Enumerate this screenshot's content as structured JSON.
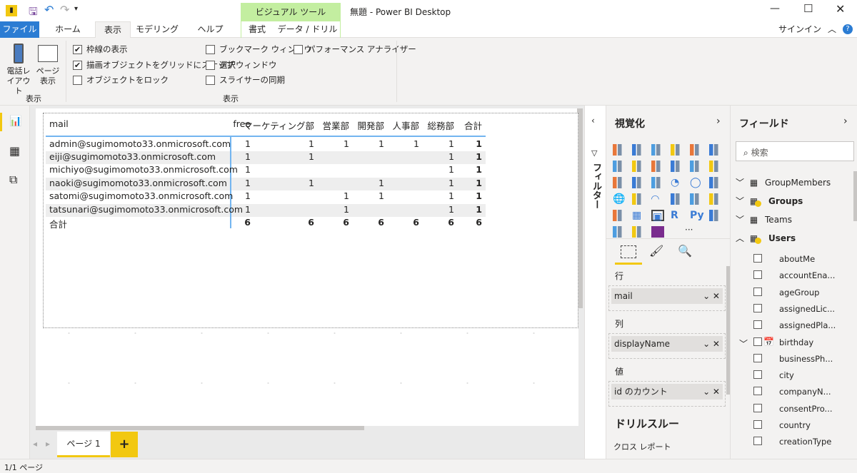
{
  "window": {
    "title": "無題 - Power BI Desktop",
    "signin": "サインイン",
    "contextual_group": "ビジュアル ツール"
  },
  "tabs": [
    "ファイル",
    "ホーム",
    "表示",
    "モデリング",
    "ヘルプ",
    "書式",
    "データ / ドリル"
  ],
  "ribbon": {
    "phone_layout": "電話レ イアウト",
    "page_view": "ページ 表示",
    "group1": "表示",
    "group2": "表示",
    "checkboxes": [
      {
        "label": "枠線の表示",
        "checked": true
      },
      {
        "label": "描画オブジェクトをグリッドにスナップ",
        "checked": true
      },
      {
        "label": "オブジェクトをロック",
        "checked": false
      },
      {
        "label": "ブックマーク ウィンドウ",
        "checked": false
      },
      {
        "label": "選択ウィンドウ",
        "checked": false
      },
      {
        "label": "スライサーの同期",
        "checked": false
      },
      {
        "label": "パフォーマンス アナライザー",
        "checked": false
      }
    ]
  },
  "matrix": {
    "headers": [
      "mail",
      "free",
      "マーケティング部",
      "営業部",
      "開発部",
      "人事部",
      "総務部",
      "合計"
    ],
    "rows": [
      [
        "admin@sugimomoto33.onmicrosoft.com",
        "1",
        "1",
        "1",
        "1",
        "1",
        "1",
        "1"
      ],
      [
        "eiji@sugimomoto33.onmicrosoft.com",
        "1",
        "1",
        "",
        "",
        "",
        "1",
        "1"
      ],
      [
        "michiyo@sugimomoto33.onmicrosoft.com",
        "1",
        "",
        "",
        "",
        "",
        "1",
        "1"
      ],
      [
        "naoki@sugimomoto33.onmicrosoft.com",
        "1",
        "1",
        "",
        "1",
        "",
        "1",
        "1"
      ],
      [
        "satomi@sugimomoto33.onmicrosoft.com",
        "1",
        "",
        "1",
        "1",
        "",
        "1",
        "1"
      ],
      [
        "tatsunari@sugimomoto33.onmicrosoft.com",
        "1",
        "",
        "1",
        "",
        "",
        "1",
        "1"
      ]
    ],
    "total": [
      "合計",
      "6",
      "6",
      "6",
      "6",
      "6",
      "6",
      "6"
    ]
  },
  "pages": {
    "tabs": [
      "ページ 1"
    ],
    "add": "+",
    "status": "1/1 ページ"
  },
  "filters": {
    "label": "フィルター"
  },
  "viz": {
    "title": "視覚化",
    "more": "···",
    "wells": [
      {
        "label": "行",
        "value": "mail"
      },
      {
        "label": "列",
        "value": "displayName"
      },
      {
        "label": "値",
        "value": "id のカウント"
      }
    ],
    "drill": "ドリルスルー",
    "cross": "クロス レポート"
  },
  "fields": {
    "title": "フィールド",
    "search_placeholder": "検索",
    "tables": [
      {
        "name": "GroupMembers",
        "expanded": false,
        "used": false
      },
      {
        "name": "Groups",
        "expanded": false,
        "used": true
      },
      {
        "name": "Teams",
        "expanded": false,
        "used": false
      },
      {
        "name": "Users",
        "expanded": true,
        "used": true
      }
    ],
    "users_fields": [
      "aboutMe",
      "accountEna...",
      "ageGroup",
      "assignedLic...",
      "assignedPla...",
      "birthday",
      "businessPh...",
      "city",
      "companyN...",
      "consentPro...",
      "country",
      "creationType"
    ]
  },
  "colors": {
    "accent": "#f2c811",
    "file_tab": "#2b7cd3",
    "context": "#c3eea0"
  }
}
